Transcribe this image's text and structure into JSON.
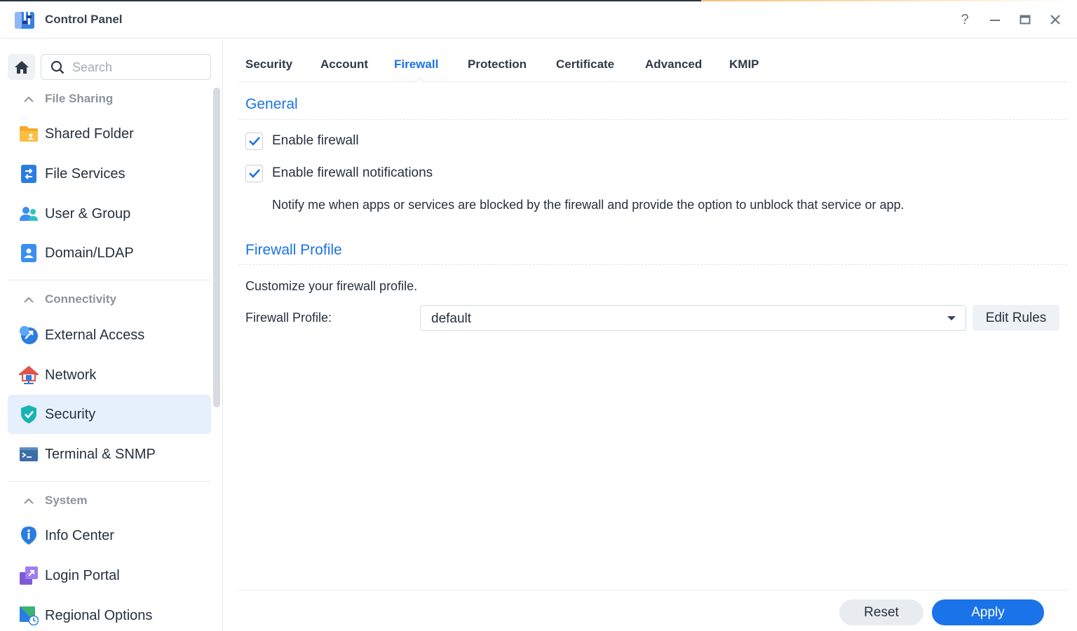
{
  "window": {
    "title": "Control Panel",
    "help_glyph": "?",
    "minimize_glyph": "—",
    "close_glyph": "✕"
  },
  "sidebar": {
    "search_placeholder": "Search",
    "groups": [
      {
        "label": "File Sharing",
        "items": [
          {
            "label": "Shared Folder",
            "icon": "shared-folder-icon"
          },
          {
            "label": "File Services",
            "icon": "file-services-icon"
          },
          {
            "label": "User & Group",
            "icon": "user-group-icon"
          },
          {
            "label": "Domain/LDAP",
            "icon": "domain-ldap-icon"
          }
        ]
      },
      {
        "label": "Connectivity",
        "items": [
          {
            "label": "External Access",
            "icon": "external-access-icon"
          },
          {
            "label": "Network",
            "icon": "network-icon"
          },
          {
            "label": "Security",
            "icon": "security-shield-icon",
            "active": true
          },
          {
            "label": "Terminal & SNMP",
            "icon": "terminal-icon"
          }
        ]
      },
      {
        "label": "System",
        "items": [
          {
            "label": "Info Center",
            "icon": "info-center-icon"
          },
          {
            "label": "Login Portal",
            "icon": "login-portal-icon"
          },
          {
            "label": "Regional Options",
            "icon": "regional-options-icon"
          }
        ]
      }
    ]
  },
  "tabs": [
    {
      "label": "Security"
    },
    {
      "label": "Account"
    },
    {
      "label": "Firewall",
      "active": true
    },
    {
      "label": "Protection"
    },
    {
      "label": "Certificate"
    },
    {
      "label": "Advanced"
    },
    {
      "label": "KMIP"
    }
  ],
  "general": {
    "title": "General",
    "enable_firewall": {
      "label": "Enable firewall",
      "checked": true
    },
    "enable_notifications": {
      "label": "Enable firewall notifications",
      "checked": true
    },
    "notifications_desc": "Notify me when apps or services are blocked by the firewall and provide the option to unblock that service or app."
  },
  "profile": {
    "title": "Firewall Profile",
    "description": "Customize your firewall profile.",
    "field_label": "Firewall Profile:",
    "selected": "default",
    "edit_rules_label": "Edit Rules"
  },
  "footer": {
    "reset_label": "Reset",
    "apply_label": "Apply"
  },
  "colors": {
    "accent": "#1a73e8",
    "active_item_bg": "#e6f0fc",
    "text": "#26313d",
    "muted": "#8c949e"
  }
}
